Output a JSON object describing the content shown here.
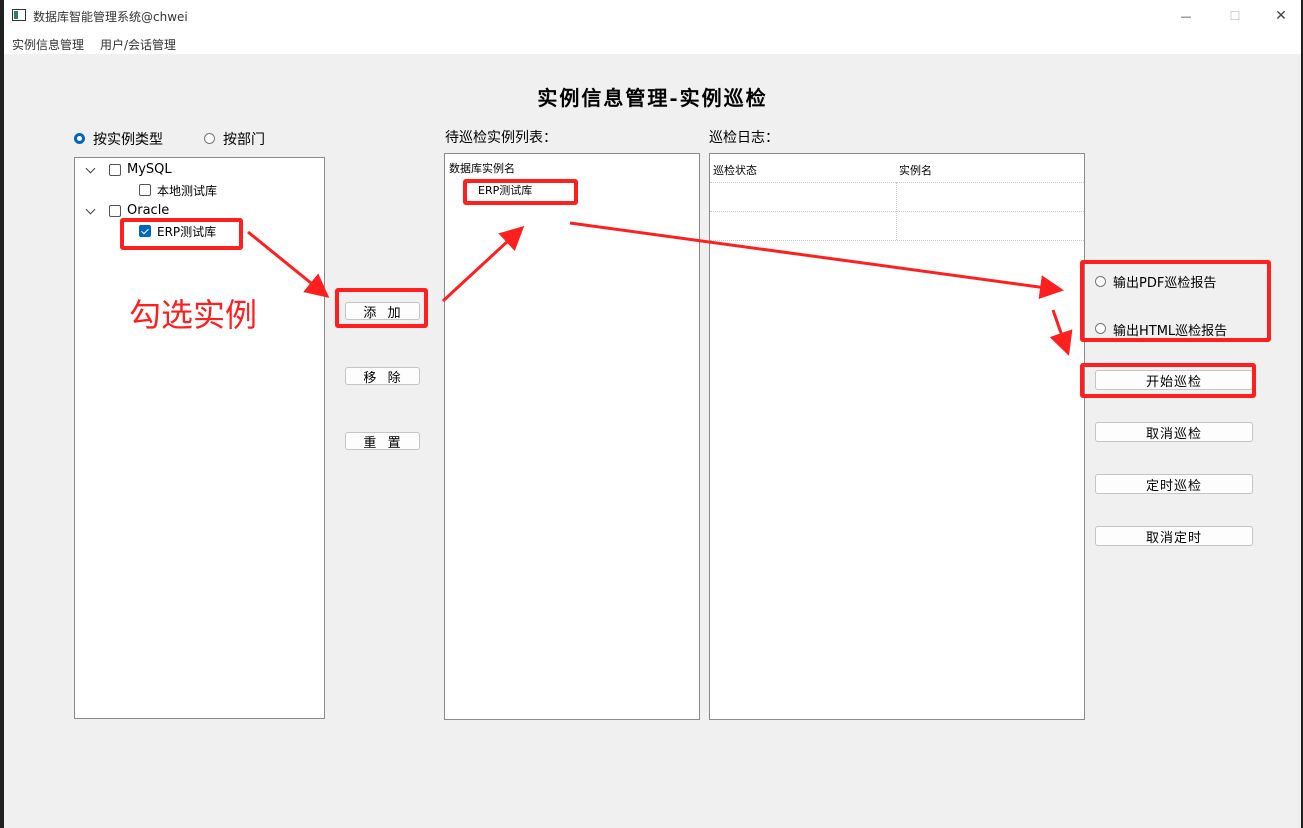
{
  "window": {
    "title": "数据库智能管理系统@chwei",
    "controls": {
      "minimize": "—",
      "maximize": "☐",
      "close": "✕"
    }
  },
  "menubar": {
    "items": [
      "实例信息管理",
      "用户/会话管理"
    ]
  },
  "page_title": "实例信息管理-实例巡检",
  "filter": {
    "by_type_label": "按实例类型",
    "by_type_checked": true,
    "by_dept_label": "按部门",
    "by_dept_checked": false
  },
  "tree": {
    "groups": [
      {
        "label": "MySQL",
        "checked": false,
        "children": [
          {
            "label": "本地测试库",
            "checked": false
          }
        ]
      },
      {
        "label": "Oracle",
        "checked": false,
        "children": [
          {
            "label": "ERP测试库",
            "checked": true
          }
        ]
      }
    ]
  },
  "buttons": {
    "add": "添  加",
    "remove": "移  除",
    "reset": "重  置"
  },
  "pending": {
    "heading": "待巡检实例列表：",
    "column_header": "数据库实例名",
    "items": [
      "ERP测试库"
    ]
  },
  "log": {
    "heading": "巡检日志：",
    "columns": [
      "巡检状态",
      "实例名"
    ]
  },
  "output": {
    "pdf_label": "输出PDF巡检报告",
    "pdf_checked": false,
    "html_label": "输出HTML巡检报告",
    "html_checked": false
  },
  "actions": {
    "start": "开始巡检",
    "cancel": "取消巡检",
    "schedule": "定时巡检",
    "cancel_schedule": "取消定时"
  },
  "annotation": {
    "text": "勾选实例",
    "color": "#ff1f1f"
  },
  "colors": {
    "accent": "#0067c0",
    "annotation": "#ff1f1f"
  }
}
